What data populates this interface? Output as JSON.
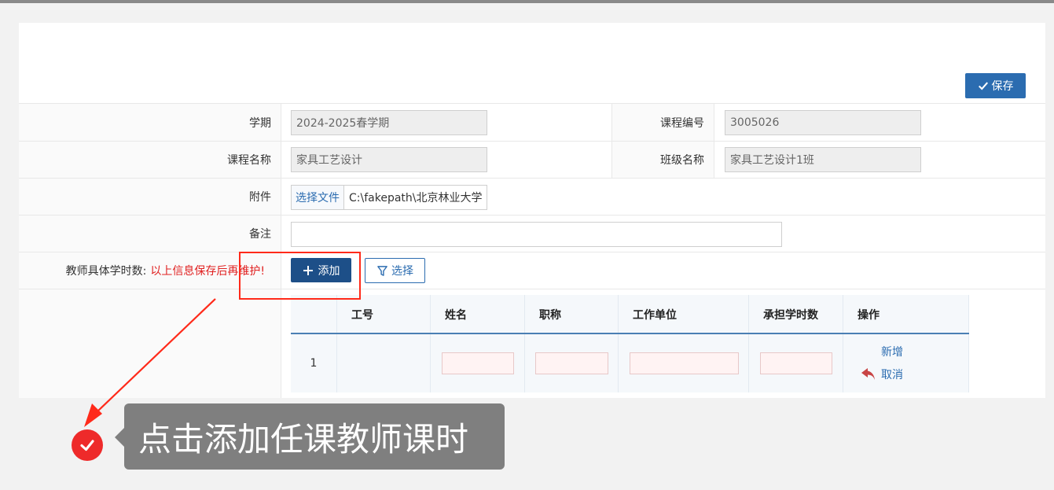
{
  "toolbar": {
    "save_label": "保存"
  },
  "form": {
    "term_label": "学期",
    "term_value": "2024-2025春学期",
    "course_code_label": "课程编号",
    "course_code_value": "3005026",
    "course_name_label": "课程名称",
    "course_name_value": "家具工艺设计",
    "class_name_label": "班级名称",
    "class_name_value": "家具工艺设计1班",
    "attachment_label": "附件",
    "choose_file_label": "选择文件",
    "file_name": "C:\\fakepath\\北京林业大学",
    "remark_label": "备注",
    "remark_value": ""
  },
  "teacher": {
    "label": "教师具体学时数:",
    "warning": "以上信息保存后再维护!",
    "add_label": "添加",
    "select_label": "选择",
    "columns": [
      "工号",
      "姓名",
      "职称",
      "工作单位",
      "承担学时数",
      "操作"
    ],
    "rows": [
      {
        "index": "1",
        "staff_id": "",
        "name": "",
        "title": "",
        "unit": "",
        "hours": ""
      }
    ],
    "op_new": "新增",
    "op_cancel": "取消"
  },
  "tooltip": {
    "text": "点击添加任课教师课时"
  },
  "colors": {
    "accent": "#2b6cb0",
    "primary_dark": "#1d4f88",
    "annotation_red": "#ff2a1a",
    "tooltip_bg": "#7f7f7f"
  }
}
